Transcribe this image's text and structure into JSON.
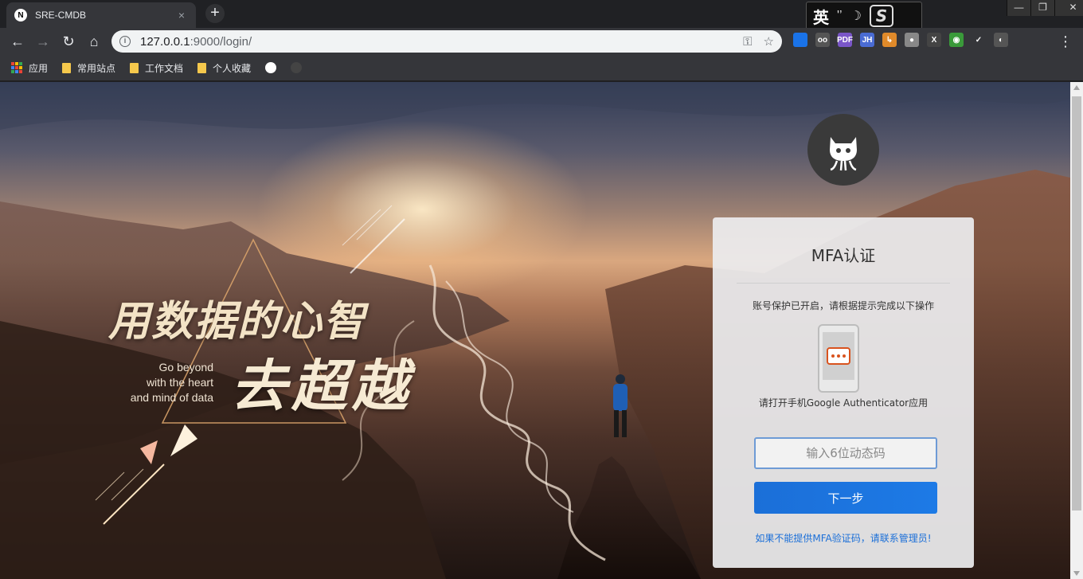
{
  "browser": {
    "tab_title": "SRE-CMDB",
    "tab_favicon": "N",
    "tab_close": "×",
    "new_tab": "+",
    "url_host": "127.0.0.1",
    "url_rest": ":9000/login/",
    "ime": {
      "lang": "英",
      "punct": "'’",
      "moon": "☽",
      "logo": "S"
    },
    "window_controls": [
      "—",
      "❐",
      "✕"
    ],
    "extensions": [
      {
        "name": "dropbox-icon",
        "label": "",
        "color": "#1a73e8"
      },
      {
        "name": "reader-icon",
        "label": "oo",
        "color": "#555"
      },
      {
        "name": "pdf-icon",
        "label": "PDF",
        "color": "#7a56c8"
      },
      {
        "name": "jh-icon",
        "label": "JH",
        "color": "#4a6cd4"
      },
      {
        "name": "tool-icon",
        "label": "↳",
        "color": "#e08a2a"
      },
      {
        "name": "cloud-icon",
        "label": "●",
        "color": "#888"
      },
      {
        "name": "x-icon",
        "label": "X",
        "color": "#444"
      },
      {
        "name": "color-icon",
        "label": "◉",
        "color": "#3a9a3a"
      },
      {
        "name": "check-icon",
        "label": "✓",
        "color": "#35363a"
      },
      {
        "name": "profile-icon",
        "label": "◐",
        "color": "#555"
      }
    ]
  },
  "bookmarks": {
    "apps_label": "应用",
    "items": [
      {
        "label": "常用站点"
      },
      {
        "label": "工作文档"
      },
      {
        "label": "个人收藏"
      }
    ]
  },
  "hero": {
    "slogan_line1": "用数据的心智",
    "slogan_line2": "去超越",
    "slogan_en": [
      "Go beyond",
      "with the heart",
      "and mind of data"
    ]
  },
  "mfa": {
    "title": "MFA认证",
    "hint": "账号保护已开启，请根据提示完成以下操作",
    "app_hint": "请打开手机Google Authenticator应用",
    "code_placeholder": "输入6位动态码",
    "next_label": "下一步",
    "admin_link": "如果不能提供MFA验证码，请联系管理员!"
  }
}
